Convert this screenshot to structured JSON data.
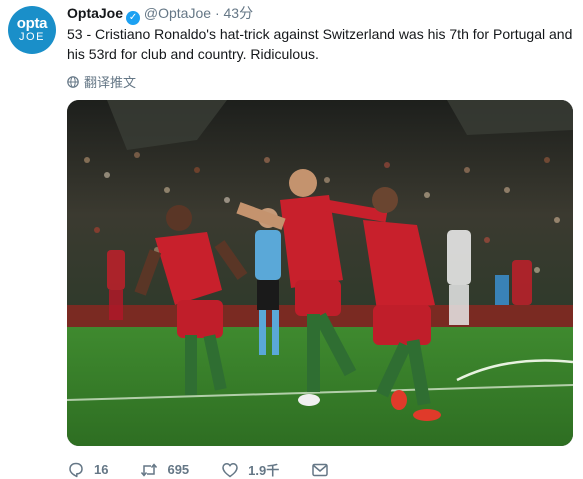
{
  "author": {
    "avatar_line1": "opta",
    "avatar_line2": "JOE",
    "name": "OptaJoe",
    "handle": "@OptaJoe",
    "separator": "·",
    "time": "43分"
  },
  "tweet": {
    "text": "53 - Cristiano Ronaldo's hat-trick against Switzerland was his 7th for Portugal and his 53rd for club and country. Ridiculous.",
    "translate_label": "翻译推文"
  },
  "actions": {
    "reply_count": "16",
    "retweet_count": "695",
    "like_count": "1.9千"
  },
  "icons": {
    "verified": "verified-badge-icon",
    "translate": "globe-icon",
    "reply": "reply-icon",
    "retweet": "retweet-icon",
    "like": "heart-icon",
    "dm": "envelope-icon"
  },
  "colors": {
    "accent": "#1da1f2",
    "secondary_text": "#657786",
    "avatar_bg": "#1a8fc9"
  }
}
